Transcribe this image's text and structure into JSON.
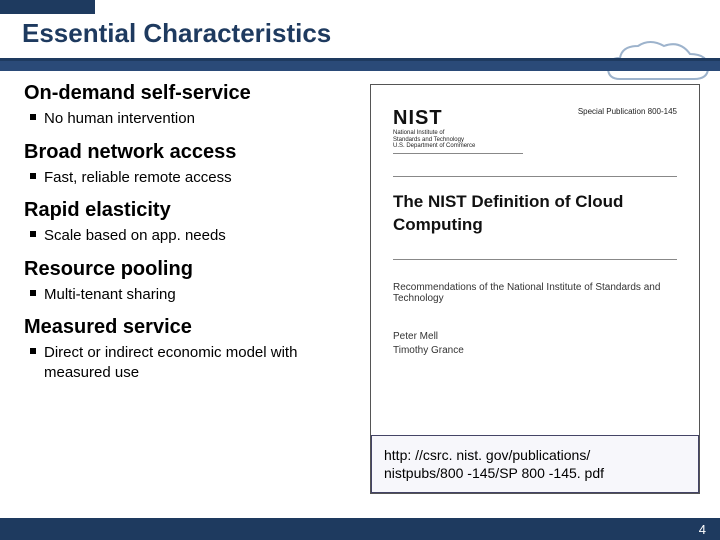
{
  "title": "Essential Characteristics",
  "sections": [
    {
      "head": "On-demand self-service",
      "bullet": "No human intervention"
    },
    {
      "head": "Broad network access",
      "bullet": "Fast, reliable remote access"
    },
    {
      "head": "Rapid elasticity",
      "bullet": "Scale based on app. needs"
    },
    {
      "head": "Resource pooling",
      "bullet": "Multi-tenant sharing"
    },
    {
      "head": "Measured service",
      "bullet": "Direct or indirect economic model with measured use"
    }
  ],
  "doc": {
    "logo_big": "NIST",
    "logo_small1": "National Institute of",
    "logo_small2": "Standards and Technology",
    "logo_small3": "U.S. Department of Commerce",
    "pubno": "Special Publication 800-145",
    "title1": "The NIST Definition of Cloud",
    "title2": "Computing",
    "sub": "Recommendations of the National Institute of Standards and Technology",
    "author1": "Peter Mell",
    "author2": "Timothy Grance"
  },
  "url_line1": "http: //csrc. nist. gov/publications/",
  "url_line2": "nistpubs/800 -145/SP 800 -145. pdf",
  "page_number": "4"
}
